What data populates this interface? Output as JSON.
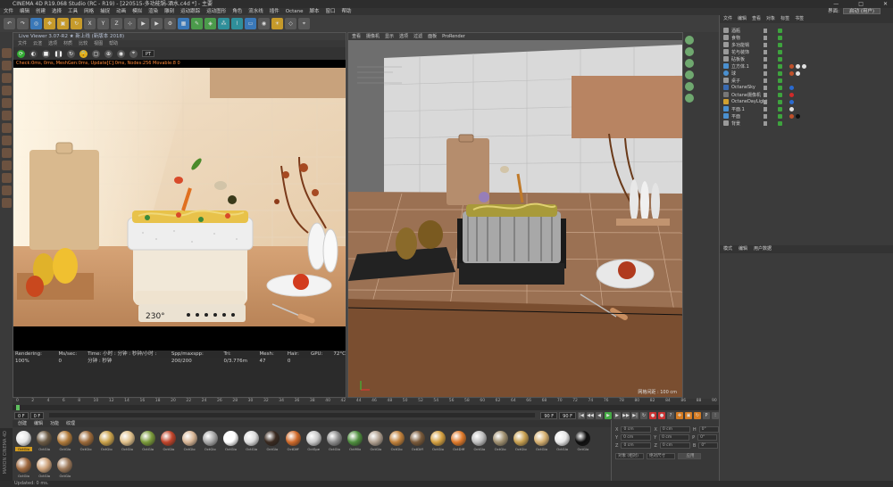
{
  "window": {
    "title": "CINEMA 4D R19.068 Studio (RC - R19) - [220515-多功能锅-酒水.c4d *] - 主要",
    "buttons": [
      "—",
      "□",
      "✕"
    ]
  },
  "menu": {
    "items": [
      "文件",
      "编辑",
      "创建",
      "选择",
      "工具",
      "网格",
      "捕捉",
      "动画",
      "模拟",
      "渲染",
      "雕刻",
      "运动跟踪",
      "运动图形",
      "角色",
      "流水线",
      "插件",
      "Octane",
      "脚本",
      "窗口",
      "帮助"
    ],
    "layout_label": "界面:",
    "layout_value": "启动 (用户)"
  },
  "live_viewer": {
    "title": "Live Viewer 3.07-R2 ★ 新上线 (新版本 2018)",
    "menu": [
      "文件",
      "云渲",
      "选项",
      "材质",
      "比较",
      "视图",
      "帮助"
    ],
    "mode": "PT",
    "status_top": "Check:0ms, 0ms, MeshGen:0ms, Update[C]:0ms, Nodes:256 Movable:8 0",
    "stats": [
      "Rendering: 100%",
      "Ms/sec: 0",
      "Time: 小时 : 分钟 : 秒钟/小时 : 分钟 : 秒钟",
      "Spp/maxspp: 200/200",
      "Tri: 0/3.776m",
      "Mesh: 47",
      "Hair: 0",
      "GPU:",
      "72°C"
    ],
    "display": "230°"
  },
  "viewport": {
    "menu": [
      "查看",
      "摄像机",
      "显示",
      "选项",
      "过滤",
      "面板",
      "ProRender"
    ],
    "footer": "网格间距 : 100 cm"
  },
  "object_manager": {
    "tabs": [
      "文件",
      "编辑",
      "查看",
      "对象",
      "标签",
      "书签"
    ],
    "objects": [
      {
        "name": "酒瓶",
        "icon": "null-icon"
      },
      {
        "name": "食物",
        "icon": "null-icon"
      },
      {
        "name": "多功能锅",
        "icon": "null-icon"
      },
      {
        "name": "花与装饰",
        "icon": "null-icon"
      },
      {
        "name": "砧板板",
        "icon": "null-icon"
      },
      {
        "name": "立方体.1",
        "icon": "cube-icon"
      },
      {
        "name": "球",
        "icon": "sphere-icon"
      },
      {
        "name": "桌子",
        "icon": "null-icon"
      },
      {
        "name": "OctaneSky",
        "icon": "sky-icon"
      },
      {
        "name": "Octane摄像机",
        "icon": "camera-icon"
      },
      {
        "name": "OctaneDayLight",
        "icon": "light-icon"
      },
      {
        "name": "平面.1",
        "icon": "plane-icon"
      },
      {
        "name": "平面",
        "icon": "plane-icon"
      },
      {
        "name": "背景",
        "icon": "null-icon"
      }
    ]
  },
  "attributes": {
    "tabs": [
      "模式",
      "编辑",
      "用户数据"
    ]
  },
  "timeline": {
    "ticks": [
      "0",
      "2",
      "4",
      "6",
      "8",
      "10",
      "12",
      "14",
      "16",
      "18",
      "20",
      "22",
      "24",
      "26",
      "28",
      "30",
      "32",
      "34",
      "36",
      "38",
      "40",
      "42",
      "44",
      "46",
      "48",
      "50",
      "52",
      "54",
      "56",
      "58",
      "60",
      "62",
      "64",
      "66",
      "68",
      "70",
      "72",
      "74",
      "76",
      "78",
      "80",
      "82",
      "84",
      "86",
      "88",
      "90"
    ],
    "current_frame": "0 F",
    "start_frame": "0 F",
    "end_frame": "90 F",
    "end_frame2": "90 F",
    "current_marker": "0 F"
  },
  "materials": {
    "tabs": [
      "创建",
      "编辑",
      "功能",
      "纹理"
    ],
    "items": [
      {
        "label": "OctGlo",
        "color": "#e6e6e6"
      },
      {
        "label": "OctGlo",
        "color": "#6b5a44"
      },
      {
        "label": "OctGlo",
        "color": "#b07a3a"
      },
      {
        "label": "OctGlo",
        "color": "#9c6a3a"
      },
      {
        "label": "OctGlo",
        "color": "#c9a14a"
      },
      {
        "label": "OctGlo",
        "color": "#e0c08a"
      },
      {
        "label": "OctGlo",
        "color": "#7a9a3a"
      },
      {
        "label": "OctGlo",
        "color": "#c1442a"
      },
      {
        "label": "OctGlo",
        "color": "#d8b696"
      },
      {
        "label": "OctGlo",
        "color": "#a7a7a7"
      },
      {
        "label": "OctGlo",
        "color": "#ffffff"
      },
      {
        "label": "OctGlo",
        "color": "#dcdcdc"
      },
      {
        "label": "OctGlo",
        "color": "#3a2a20"
      },
      {
        "label": "OctDiff",
        "color": "#d06a2a"
      },
      {
        "label": "OctSpe",
        "color": "#c9c9c9"
      },
      {
        "label": "OctGlo",
        "color": "#8c8c8c"
      },
      {
        "label": "OctMix",
        "color": "#4e8e3e"
      },
      {
        "label": "OctGlo",
        "color": "#b0a090"
      },
      {
        "label": "OctGlo",
        "color": "#c0803a"
      },
      {
        "label": "OctDiff",
        "color": "#7a5a3a"
      },
      {
        "label": "OctGlo",
        "color": "#d4a040"
      },
      {
        "label": "OctDiff",
        "color": "#e07a2a"
      },
      {
        "label": "OctGlo",
        "color": "#bfbfbf"
      },
      {
        "label": "OctGlo",
        "color": "#a09070"
      },
      {
        "label": "OctGlo",
        "color": "#c8a050"
      },
      {
        "label": "OctGlo",
        "color": "#d6b070"
      },
      {
        "label": "OctGlo",
        "color": "#e8e8e8"
      },
      {
        "label": "OctGlo",
        "color": "#0e0e0e"
      },
      {
        "label": "OctGlo",
        "color": "#a06a40"
      },
      {
        "label": "OctGlo",
        "color": "#cda27a"
      },
      {
        "label": "OctGlo",
        "color": "#9e7a5a"
      }
    ],
    "first_selected": "OctGlo"
  },
  "coordinates": {
    "rows": [
      {
        "a": "X",
        "v1": "0 cm",
        "b": "X",
        "v2": "0 cm",
        "c": "H",
        "v3": "0°"
      },
      {
        "a": "Y",
        "v1": "0 cm",
        "b": "Y",
        "v2": "0 cm",
        "c": "P",
        "v3": "0°"
      },
      {
        "a": "Z",
        "v1": "0 cm",
        "b": "Z",
        "v2": "0 cm",
        "c": "B",
        "v3": "0°"
      }
    ],
    "mode": "对象 (相对)",
    "size_mode": "绝对尺寸",
    "apply": "应用"
  },
  "statusbar": "Updated: 0 ms.",
  "side_label": "MAXON CINEMA 4D"
}
